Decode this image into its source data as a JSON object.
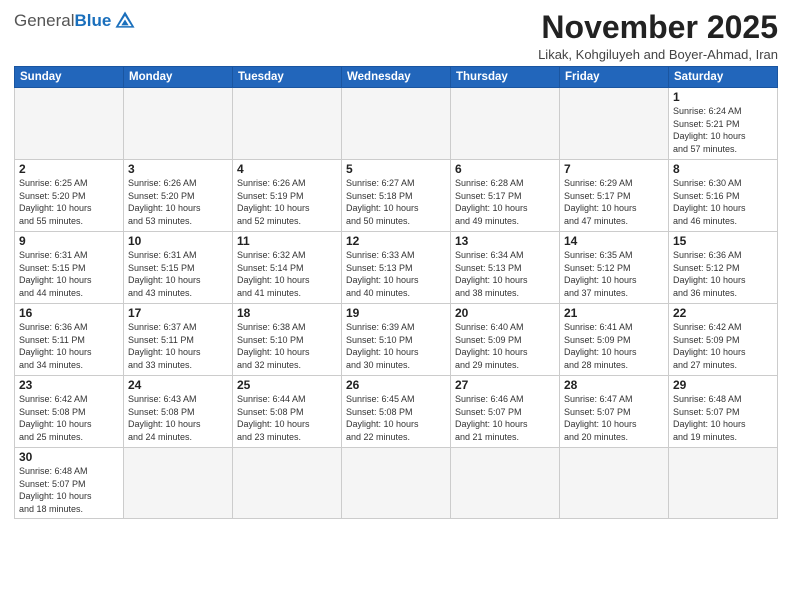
{
  "header": {
    "logo_general": "General",
    "logo_blue": "Blue",
    "month_title": "November 2025",
    "subtitle": "Likak, Kohgiluyeh and Boyer-Ahmad, Iran"
  },
  "weekdays": [
    "Sunday",
    "Monday",
    "Tuesday",
    "Wednesday",
    "Thursday",
    "Friday",
    "Saturday"
  ],
  "days": {
    "1": {
      "sunrise": "6:24 AM",
      "sunset": "5:21 PM",
      "daylight_h": "10",
      "daylight_m": "57"
    },
    "2": {
      "sunrise": "6:25 AM",
      "sunset": "5:20 PM",
      "daylight_h": "10",
      "daylight_m": "55"
    },
    "3": {
      "sunrise": "6:26 AM",
      "sunset": "5:20 PM",
      "daylight_h": "10",
      "daylight_m": "53"
    },
    "4": {
      "sunrise": "6:26 AM",
      "sunset": "5:19 PM",
      "daylight_h": "10",
      "daylight_m": "52"
    },
    "5": {
      "sunrise": "6:27 AM",
      "sunset": "5:18 PM",
      "daylight_h": "10",
      "daylight_m": "50"
    },
    "6": {
      "sunrise": "6:28 AM",
      "sunset": "5:17 PM",
      "daylight_h": "10",
      "daylight_m": "49"
    },
    "7": {
      "sunrise": "6:29 AM",
      "sunset": "5:17 PM",
      "daylight_h": "10",
      "daylight_m": "47"
    },
    "8": {
      "sunrise": "6:30 AM",
      "sunset": "5:16 PM",
      "daylight_h": "10",
      "daylight_m": "46"
    },
    "9": {
      "sunrise": "6:31 AM",
      "sunset": "5:15 PM",
      "daylight_h": "10",
      "daylight_m": "44"
    },
    "10": {
      "sunrise": "6:31 AM",
      "sunset": "5:15 PM",
      "daylight_h": "10",
      "daylight_m": "43"
    },
    "11": {
      "sunrise": "6:32 AM",
      "sunset": "5:14 PM",
      "daylight_h": "10",
      "daylight_m": "41"
    },
    "12": {
      "sunrise": "6:33 AM",
      "sunset": "5:13 PM",
      "daylight_h": "10",
      "daylight_m": "40"
    },
    "13": {
      "sunrise": "6:34 AM",
      "sunset": "5:13 PM",
      "daylight_h": "10",
      "daylight_m": "38"
    },
    "14": {
      "sunrise": "6:35 AM",
      "sunset": "5:12 PM",
      "daylight_h": "10",
      "daylight_m": "37"
    },
    "15": {
      "sunrise": "6:36 AM",
      "sunset": "5:12 PM",
      "daylight_h": "10",
      "daylight_m": "36"
    },
    "16": {
      "sunrise": "6:36 AM",
      "sunset": "5:11 PM",
      "daylight_h": "10",
      "daylight_m": "34"
    },
    "17": {
      "sunrise": "6:37 AM",
      "sunset": "5:11 PM",
      "daylight_h": "10",
      "daylight_m": "33"
    },
    "18": {
      "sunrise": "6:38 AM",
      "sunset": "5:10 PM",
      "daylight_h": "10",
      "daylight_m": "32"
    },
    "19": {
      "sunrise": "6:39 AM",
      "sunset": "5:10 PM",
      "daylight_h": "10",
      "daylight_m": "30"
    },
    "20": {
      "sunrise": "6:40 AM",
      "sunset": "5:09 PM",
      "daylight_h": "10",
      "daylight_m": "29"
    },
    "21": {
      "sunrise": "6:41 AM",
      "sunset": "5:09 PM",
      "daylight_h": "10",
      "daylight_m": "28"
    },
    "22": {
      "sunrise": "6:42 AM",
      "sunset": "5:09 PM",
      "daylight_h": "10",
      "daylight_m": "27"
    },
    "23": {
      "sunrise": "6:42 AM",
      "sunset": "5:08 PM",
      "daylight_h": "10",
      "daylight_m": "25"
    },
    "24": {
      "sunrise": "6:43 AM",
      "sunset": "5:08 PM",
      "daylight_h": "10",
      "daylight_m": "24"
    },
    "25": {
      "sunrise": "6:44 AM",
      "sunset": "5:08 PM",
      "daylight_h": "10",
      "daylight_m": "23"
    },
    "26": {
      "sunrise": "6:45 AM",
      "sunset": "5:08 PM",
      "daylight_h": "10",
      "daylight_m": "22"
    },
    "27": {
      "sunrise": "6:46 AM",
      "sunset": "5:07 PM",
      "daylight_h": "10",
      "daylight_m": "21"
    },
    "28": {
      "sunrise": "6:47 AM",
      "sunset": "5:07 PM",
      "daylight_h": "10",
      "daylight_m": "20"
    },
    "29": {
      "sunrise": "6:48 AM",
      "sunset": "5:07 PM",
      "daylight_h": "10",
      "daylight_m": "19"
    },
    "30": {
      "sunrise": "6:48 AM",
      "sunset": "5:07 PM",
      "daylight_h": "10",
      "daylight_m": "18"
    }
  }
}
